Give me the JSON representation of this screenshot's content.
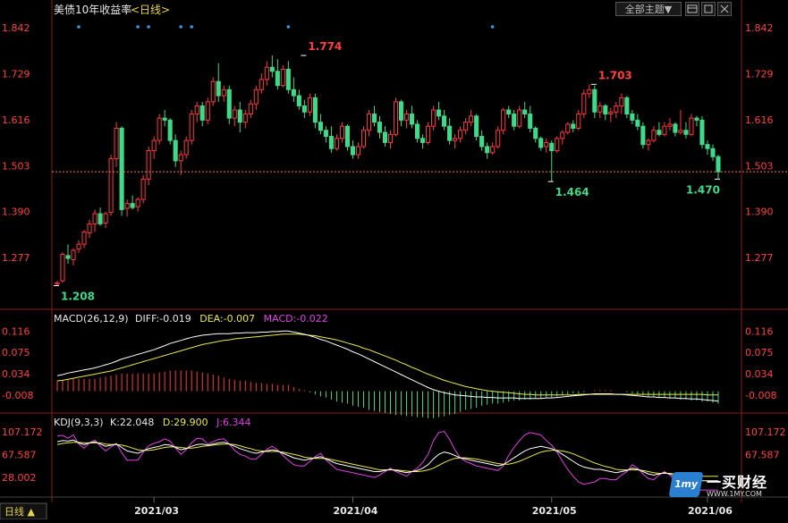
{
  "header": {
    "title": "美债10年收益率",
    "period": "<日线>",
    "theme_button": "全部主题▼"
  },
  "icons": [
    "layout-icon",
    "window-icon",
    "close-icon"
  ],
  "colors": {
    "up": "#ff3b3b",
    "down": "#3fd98a",
    "axis_red": "#ff4040",
    "diff": "#ffffff",
    "dea": "#e8e84a",
    "k": "#ffffff",
    "d": "#e8e84a",
    "j": "#e040e0",
    "price_line": "#ff8040",
    "marker": "#3a9ad9"
  },
  "main_axis": {
    "ticks": [
      "1.842",
      "1.729",
      "1.616",
      "1.503",
      "1.390",
      "1.277"
    ],
    "tick_values": [
      1.842,
      1.729,
      1.616,
      1.503,
      1.39,
      1.277
    ]
  },
  "macd": {
    "label": "MACD(26,12,9)",
    "diff_text": "DIFF:-0.019",
    "dea_text": "DEA:-0.007",
    "macd_text": "MACD:-0.022",
    "ticks": [
      "0.116",
      "0.075",
      "0.034",
      "-0.008"
    ],
    "tick_values": [
      0.116,
      0.075,
      0.034,
      -0.008
    ]
  },
  "kdj": {
    "label": "KDJ(9,3,3)",
    "k_text": "K:22.048",
    "d_text": "D:29.900",
    "j_text": "J:6.344",
    "ticks": [
      "107.172",
      "67.587",
      "28.002"
    ],
    "tick_values": [
      107.172,
      67.587,
      28.002
    ]
  },
  "footer": {
    "period_toggle": "日线 ▲",
    "months": [
      "2021/03",
      "2021/04",
      "2021/05",
      "2021/06"
    ]
  },
  "logo": {
    "badge": "1my",
    "name": "一买财经",
    "url": "WWW.1MY.COM"
  },
  "chart_data": {
    "type": "candlestick",
    "title": "美债10年收益率",
    "ylim": [
      1.185,
      1.862
    ],
    "annotations": [
      {
        "text": "1.208",
        "index": 0,
        "value": 1.208,
        "kind": "low"
      },
      {
        "text": "1.774",
        "index": 46,
        "value": 1.774,
        "kind": "high"
      },
      {
        "text": "1.464",
        "index": 92,
        "value": 1.464,
        "kind": "low"
      },
      {
        "text": "1.703",
        "index": 100,
        "value": 1.703,
        "kind": "high"
      },
      {
        "text": "1.470",
        "index": 123,
        "value": 1.47,
        "kind": "low"
      }
    ],
    "last_close": 1.488,
    "marker_indices": [
      4,
      15,
      17,
      23,
      25,
      43,
      81
    ],
    "ohlc": [
      [
        1.212,
        1.22,
        1.208,
        1.215
      ],
      [
        1.22,
        1.29,
        1.215,
        1.285
      ],
      [
        1.282,
        1.31,
        1.262,
        1.275
      ],
      [
        1.272,
        1.3,
        1.258,
        1.295
      ],
      [
        1.298,
        1.32,
        1.288,
        1.31
      ],
      [
        1.31,
        1.345,
        1.3,
        1.34
      ],
      [
        1.338,
        1.37,
        1.325,
        1.36
      ],
      [
        1.36,
        1.395,
        1.34,
        1.385
      ],
      [
        1.385,
        1.4,
        1.355,
        1.36
      ],
      [
        1.362,
        1.39,
        1.35,
        1.385
      ],
      [
        1.388,
        1.53,
        1.38,
        1.52
      ],
      [
        1.52,
        1.61,
        1.5,
        1.595
      ],
      [
        1.595,
        1.6,
        1.38,
        1.395
      ],
      [
        1.398,
        1.42,
        1.378,
        1.41
      ],
      [
        1.41,
        1.43,
        1.395,
        1.4
      ],
      [
        1.402,
        1.425,
        1.39,
        1.42
      ],
      [
        1.42,
        1.48,
        1.41,
        1.47
      ],
      [
        1.47,
        1.55,
        1.455,
        1.54
      ],
      [
        1.54,
        1.575,
        1.52,
        1.565
      ],
      [
        1.565,
        1.63,
        1.555,
        1.62
      ],
      [
        1.62,
        1.64,
        1.6,
        1.615
      ],
      [
        1.615,
        1.62,
        1.555,
        1.565
      ],
      [
        1.565,
        1.58,
        1.5,
        1.515
      ],
      [
        1.515,
        1.54,
        1.48,
        1.53
      ],
      [
        1.53,
        1.575,
        1.52,
        1.565
      ],
      [
        1.565,
        1.64,
        1.555,
        1.63
      ],
      [
        1.63,
        1.66,
        1.61,
        1.65
      ],
      [
        1.65,
        1.66,
        1.6,
        1.615
      ],
      [
        1.615,
        1.67,
        1.605,
        1.66
      ],
      [
        1.66,
        1.72,
        1.65,
        1.71
      ],
      [
        1.71,
        1.755,
        1.66,
        1.675
      ],
      [
        1.675,
        1.7,
        1.66,
        1.69
      ],
      [
        1.69,
        1.7,
        1.605,
        1.62
      ],
      [
        1.62,
        1.65,
        1.6,
        1.64
      ],
      [
        1.64,
        1.66,
        1.585,
        1.61
      ],
      [
        1.61,
        1.64,
        1.595,
        1.63
      ],
      [
        1.63,
        1.665,
        1.62,
        1.655
      ],
      [
        1.655,
        1.7,
        1.64,
        1.69
      ],
      [
        1.69,
        1.73,
        1.68,
        1.715
      ],
      [
        1.715,
        1.76,
        1.7,
        1.745
      ],
      [
        1.745,
        1.774,
        1.72,
        1.735
      ],
      [
        1.735,
        1.765,
        1.69,
        1.7
      ],
      [
        1.7,
        1.75,
        1.695,
        1.74
      ],
      [
        1.74,
        1.76,
        1.68,
        1.69
      ],
      [
        1.69,
        1.72,
        1.66,
        1.675
      ],
      [
        1.675,
        1.69,
        1.64,
        1.65
      ],
      [
        1.65,
        1.665,
        1.62,
        1.635
      ],
      [
        1.635,
        1.68,
        1.625,
        1.67
      ],
      [
        1.67,
        1.68,
        1.595,
        1.61
      ],
      [
        1.61,
        1.63,
        1.58,
        1.59
      ],
      [
        1.59,
        1.6,
        1.56,
        1.575
      ],
      [
        1.575,
        1.6,
        1.535,
        1.545
      ],
      [
        1.545,
        1.58,
        1.54,
        1.57
      ],
      [
        1.57,
        1.61,
        1.56,
        1.6
      ],
      [
        1.6,
        1.605,
        1.54,
        1.55
      ],
      [
        1.55,
        1.565,
        1.52,
        1.53
      ],
      [
        1.53,
        1.56,
        1.52,
        1.55
      ],
      [
        1.55,
        1.6,
        1.545,
        1.59
      ],
      [
        1.59,
        1.64,
        1.575,
        1.63
      ],
      [
        1.63,
        1.65,
        1.6,
        1.61
      ],
      [
        1.61,
        1.625,
        1.57,
        1.585
      ],
      [
        1.585,
        1.6,
        1.55,
        1.56
      ],
      [
        1.56,
        1.59,
        1.545,
        1.58
      ],
      [
        1.58,
        1.67,
        1.575,
        1.66
      ],
      [
        1.66,
        1.665,
        1.6,
        1.615
      ],
      [
        1.615,
        1.64,
        1.595,
        1.63
      ],
      [
        1.63,
        1.65,
        1.595,
        1.605
      ],
      [
        1.605,
        1.615,
        1.56,
        1.57
      ],
      [
        1.57,
        1.58,
        1.545,
        1.56
      ],
      [
        1.56,
        1.61,
        1.555,
        1.6
      ],
      [
        1.6,
        1.65,
        1.59,
        1.64
      ],
      [
        1.64,
        1.66,
        1.615,
        1.625
      ],
      [
        1.625,
        1.64,
        1.59,
        1.6
      ],
      [
        1.6,
        1.62,
        1.555,
        1.565
      ],
      [
        1.565,
        1.58,
        1.545,
        1.57
      ],
      [
        1.57,
        1.6,
        1.56,
        1.59
      ],
      [
        1.59,
        1.62,
        1.58,
        1.61
      ],
      [
        1.61,
        1.64,
        1.6,
        1.625
      ],
      [
        1.625,
        1.63,
        1.565,
        1.575
      ],
      [
        1.575,
        1.59,
        1.54,
        1.55
      ],
      [
        1.55,
        1.56,
        1.52,
        1.535
      ],
      [
        1.535,
        1.56,
        1.53,
        1.55
      ],
      [
        1.55,
        1.6,
        1.545,
        1.59
      ],
      [
        1.59,
        1.645,
        1.58,
        1.64
      ],
      [
        1.64,
        1.65,
        1.62,
        1.63
      ],
      [
        1.63,
        1.64,
        1.59,
        1.6
      ],
      [
        1.6,
        1.65,
        1.595,
        1.64
      ],
      [
        1.64,
        1.66,
        1.62,
        1.63
      ],
      [
        1.63,
        1.65,
        1.585,
        1.595
      ],
      [
        1.595,
        1.6,
        1.56,
        1.57
      ],
      [
        1.57,
        1.575,
        1.54,
        1.548
      ],
      [
        1.55,
        1.57,
        1.535,
        1.56
      ],
      [
        1.558,
        1.565,
        1.464,
        1.54
      ],
      [
        1.54,
        1.575,
        1.535,
        1.57
      ],
      [
        1.57,
        1.59,
        1.555,
        1.585
      ],
      [
        1.585,
        1.61,
        1.58,
        1.605
      ],
      [
        1.605,
        1.615,
        1.585,
        1.595
      ],
      [
        1.595,
        1.64,
        1.59,
        1.63
      ],
      [
        1.63,
        1.69,
        1.62,
        1.68
      ],
      [
        1.68,
        1.703,
        1.67,
        1.69
      ],
      [
        1.69,
        1.7,
        1.62,
        1.635
      ],
      [
        1.635,
        1.66,
        1.62,
        1.65
      ],
      [
        1.65,
        1.655,
        1.615,
        1.63
      ],
      [
        1.63,
        1.645,
        1.61,
        1.635
      ],
      [
        1.635,
        1.66,
        1.62,
        1.65
      ],
      [
        1.65,
        1.68,
        1.63,
        1.67
      ],
      [
        1.67,
        1.675,
        1.62,
        1.63
      ],
      [
        1.63,
        1.64,
        1.605,
        1.615
      ],
      [
        1.615,
        1.63,
        1.59,
        1.6
      ],
      [
        1.6,
        1.61,
        1.545,
        1.555
      ],
      [
        1.555,
        1.57,
        1.54,
        1.565
      ],
      [
        1.565,
        1.6,
        1.56,
        1.59
      ],
      [
        1.59,
        1.61,
        1.575,
        1.58
      ],
      [
        1.58,
        1.61,
        1.575,
        1.6
      ],
      [
        1.6,
        1.62,
        1.59,
        1.605
      ],
      [
        1.605,
        1.61,
        1.575,
        1.585
      ],
      [
        1.585,
        1.64,
        1.58,
        1.59
      ],
      [
        1.59,
        1.61,
        1.57,
        1.58
      ],
      [
        1.58,
        1.63,
        1.575,
        1.62
      ],
      [
        1.62,
        1.625,
        1.6,
        1.615
      ],
      [
        1.615,
        1.625,
        1.545,
        1.555
      ],
      [
        1.555,
        1.565,
        1.53,
        1.545
      ],
      [
        1.545,
        1.555,
        1.515,
        1.525
      ],
      [
        1.525,
        1.53,
        1.47,
        1.488
      ]
    ],
    "macd_series": {
      "diff": [
        0.03,
        0.032,
        0.035,
        0.037,
        0.039,
        0.041,
        0.043,
        0.045,
        0.048,
        0.051,
        0.054,
        0.058,
        0.062,
        0.065,
        0.068,
        0.071,
        0.074,
        0.077,
        0.08,
        0.084,
        0.088,
        0.092,
        0.095,
        0.098,
        0.101,
        0.104,
        0.106,
        0.108,
        0.109,
        0.11,
        0.111,
        0.111,
        0.111,
        0.112,
        0.112,
        0.113,
        0.113,
        0.113,
        0.114,
        0.114,
        0.115,
        0.115,
        0.116,
        0.116,
        0.114,
        0.112,
        0.11,
        0.107,
        0.104,
        0.1,
        0.097,
        0.093,
        0.089,
        0.085,
        0.081,
        0.076,
        0.072,
        0.067,
        0.062,
        0.057,
        0.052,
        0.047,
        0.042,
        0.037,
        0.032,
        0.027,
        0.022,
        0.017,
        0.012,
        0.007,
        0.003,
        0.0,
        -0.003,
        -0.005,
        -0.007,
        -0.008,
        -0.009,
        -0.01,
        -0.011,
        -0.011,
        -0.012,
        -0.012,
        -0.013,
        -0.013,
        -0.013,
        -0.013,
        -0.014,
        -0.014,
        -0.014,
        -0.014,
        -0.014,
        -0.013,
        -0.013,
        -0.012,
        -0.011,
        -0.01,
        -0.009,
        -0.008,
        -0.007,
        -0.006,
        -0.005,
        -0.005,
        -0.005,
        -0.005,
        -0.006,
        -0.006,
        -0.007,
        -0.008,
        -0.009,
        -0.01,
        -0.011,
        -0.011,
        -0.012,
        -0.012,
        -0.013,
        -0.013,
        -0.014,
        -0.014,
        -0.015,
        -0.015,
        -0.016,
        -0.017,
        -0.018,
        -0.019
      ],
      "dea": [
        0.02,
        0.021,
        0.023,
        0.025,
        0.027,
        0.029,
        0.031,
        0.033,
        0.035,
        0.037,
        0.039,
        0.042,
        0.045,
        0.048,
        0.051,
        0.054,
        0.057,
        0.06,
        0.063,
        0.066,
        0.069,
        0.072,
        0.075,
        0.078,
        0.081,
        0.084,
        0.087,
        0.09,
        0.092,
        0.094,
        0.096,
        0.098,
        0.099,
        0.101,
        0.102,
        0.103,
        0.104,
        0.105,
        0.106,
        0.107,
        0.108,
        0.109,
        0.11,
        0.11,
        0.11,
        0.11,
        0.109,
        0.108,
        0.107,
        0.105,
        0.103,
        0.101,
        0.099,
        0.096,
        0.093,
        0.09,
        0.087,
        0.083,
        0.08,
        0.076,
        0.072,
        0.068,
        0.064,
        0.06,
        0.055,
        0.051,
        0.046,
        0.042,
        0.037,
        0.033,
        0.029,
        0.025,
        0.021,
        0.018,
        0.015,
        0.012,
        0.009,
        0.007,
        0.005,
        0.003,
        0.001,
        0.0,
        -0.001,
        -0.002,
        -0.003,
        -0.004,
        -0.005,
        -0.006,
        -0.006,
        -0.007,
        -0.007,
        -0.007,
        -0.007,
        -0.007,
        -0.007,
        -0.007,
        -0.007,
        -0.006,
        -0.006,
        -0.006,
        -0.006,
        -0.006,
        -0.006,
        -0.006,
        -0.006,
        -0.006,
        -0.006,
        -0.006,
        -0.006,
        -0.006,
        -0.006,
        -0.006,
        -0.006,
        -0.006,
        -0.006,
        -0.006,
        -0.006,
        -0.006,
        -0.006,
        -0.006,
        -0.006,
        -0.007,
        -0.007,
        -0.007
      ]
    },
    "kdj_series": {
      "k": [
        90,
        92,
        91,
        93,
        88,
        85,
        88,
        90,
        86,
        82,
        84,
        86,
        80,
        74,
        72,
        70,
        74,
        78,
        80,
        82,
        85,
        84,
        80,
        76,
        78,
        82,
        85,
        86,
        84,
        86,
        88,
        89,
        86,
        82,
        78,
        75,
        72,
        70,
        72,
        74,
        76,
        74,
        70,
        66,
        62,
        60,
        58,
        60,
        62,
        64,
        60,
        56,
        52,
        50,
        48,
        46,
        44,
        42,
        40,
        38,
        38,
        40,
        42,
        40,
        38,
        36,
        38,
        40,
        44,
        50,
        60,
        68,
        72,
        70,
        66,
        62,
        60,
        58,
        56,
        54,
        52,
        50,
        48,
        50,
        56,
        62,
        68,
        74,
        78,
        80,
        82,
        80,
        78,
        74,
        68,
        62,
        56,
        50,
        46,
        44,
        42,
        42,
        40,
        38,
        36,
        38,
        40,
        44,
        42,
        38,
        34,
        32,
        34,
        36,
        34,
        30,
        28,
        26,
        24,
        22,
        22,
        22,
        22,
        22
      ],
      "d": [
        85,
        87,
        88,
        89,
        89,
        88,
        88,
        88,
        88,
        86,
        85,
        85,
        84,
        82,
        79,
        76,
        75,
        75,
        76,
        78,
        80,
        81,
        81,
        80,
        79,
        79,
        80,
        82,
        83,
        84,
        85,
        86,
        86,
        85,
        83,
        80,
        78,
        75,
        74,
        73,
        73,
        73,
        72,
        70,
        68,
        66,
        63,
        62,
        61,
        61,
        61,
        59,
        57,
        55,
        53,
        51,
        49,
        47,
        45,
        43,
        41,
        41,
        41,
        41,
        40,
        39,
        38,
        38,
        39,
        41,
        44,
        49,
        54,
        58,
        61,
        62,
        62,
        61,
        60,
        58,
        56,
        54,
        52,
        51,
        51,
        53,
        56,
        60,
        64,
        68,
        72,
        74,
        75,
        75,
        74,
        72,
        69,
        65,
        61,
        57,
        53,
        50,
        47,
        45,
        42,
        41,
        41,
        41,
        41,
        40,
        38,
        36,
        35,
        35,
        35,
        34,
        32,
        31,
        30,
        30,
        30,
        30,
        30,
        30
      ],
      "j": [
        100,
        101,
        96,
        102,
        86,
        79,
        88,
        93,
        82,
        74,
        81,
        87,
        71,
        58,
        58,
        58,
        72,
        83,
        87,
        90,
        95,
        91,
        79,
        68,
        76,
        88,
        96,
        95,
        86,
        90,
        94,
        95,
        86,
        75,
        68,
        65,
        60,
        60,
        68,
        77,
        82,
        76,
        66,
        58,
        50,
        48,
        48,
        56,
        64,
        70,
        58,
        50,
        42,
        40,
        38,
        36,
        34,
        32,
        30,
        28,
        32,
        38,
        44,
        38,
        34,
        30,
        38,
        44,
        54,
        68,
        92,
        106,
        108,
        94,
        76,
        62,
        56,
        52,
        48,
        46,
        44,
        42,
        40,
        48,
        66,
        80,
        92,
        102,
        106,
        104,
        102,
        92,
        84,
        72,
        56,
        42,
        30,
        20,
        16,
        18,
        20,
        26,
        26,
        24,
        24,
        32,
        38,
        50,
        44,
        34,
        26,
        24,
        32,
        38,
        32,
        22,
        20,
        16,
        12,
        6,
        6,
        6,
        6,
        6
      ]
    }
  }
}
